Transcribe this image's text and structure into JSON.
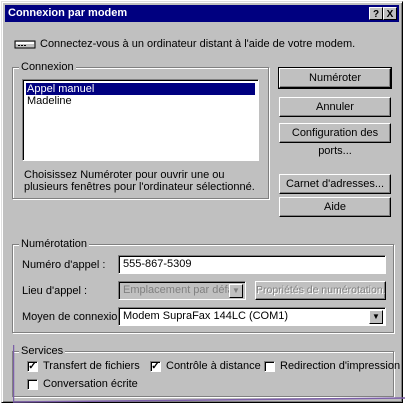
{
  "dialog": {
    "title": "Connexion par modem",
    "help_button": "?",
    "close_button": "X",
    "intro": "Connectez-vous à un ordinateur distant à l'aide de votre modem.",
    "modem_icon": "modem-icon"
  },
  "connexion": {
    "label": "Connexion",
    "items": [
      {
        "label": "Appel manuel",
        "selected": true
      },
      {
        "label": "Madeline",
        "selected": false
      }
    ],
    "hint": "Choisissez Numéroter pour ouvrir une ou plusieurs fenêtres pour l'ordinateur sélectionné."
  },
  "buttons": {
    "numeroter": "Numéroter",
    "annuler": "Annuler",
    "config_ports": "Configuration des ports...",
    "carnet": "Carnet d'adresses...",
    "aide": "Aide"
  },
  "numerotation": {
    "label": "Numérotation",
    "numero_label": "Numéro d'appel :",
    "numero_value": "555-867-5309",
    "lieu_label": "Lieu d'appel :",
    "lieu_value": "Emplacement par défaut",
    "proprietes": "Propriétés de numérotation...",
    "moyen_label": "Moyen de connexion :",
    "moyen_value": "Modem SupraFax 144LC (COM1)"
  },
  "services": {
    "label": "Services",
    "transfert": {
      "label": "Transfert de fichiers",
      "checked": true
    },
    "controle": {
      "label": "Contrôle à distance",
      "checked": true
    },
    "redirection": {
      "label": "Redirection d'impression",
      "checked": false
    },
    "conversation": {
      "label": "Conversation écrite",
      "checked": false
    }
  },
  "colors": {
    "titlebar": "#000080",
    "face": "#c0c0c0",
    "callout": "#7b5ea7"
  }
}
